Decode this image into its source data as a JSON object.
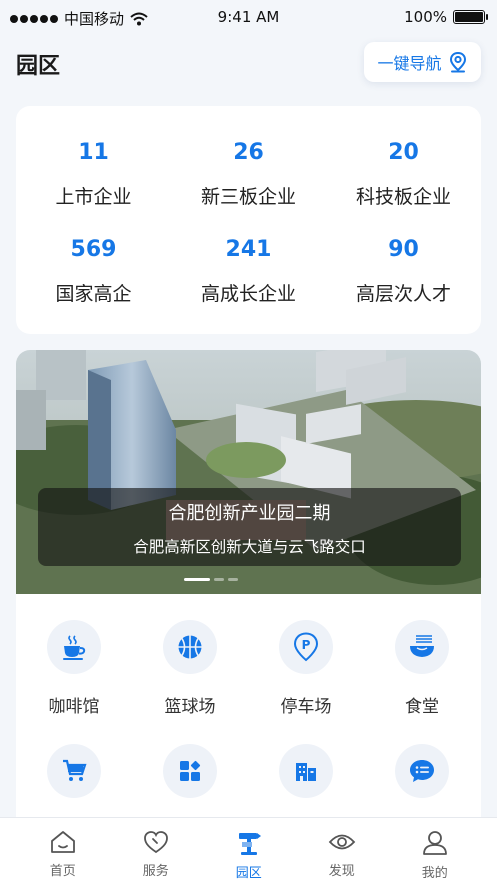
{
  "status_bar": {
    "carrier": "中国移动",
    "time": "9:41 AM",
    "battery": "100%"
  },
  "header": {
    "title": "园区",
    "nav_button": "一键导航"
  },
  "stats": [
    {
      "value": "11",
      "label": "上市企业"
    },
    {
      "value": "26",
      "label": "新三板企业"
    },
    {
      "value": "20",
      "label": "科技板企业"
    },
    {
      "value": "569",
      "label": "国家高企"
    },
    {
      "value": "241",
      "label": "高成长企业"
    },
    {
      "value": "90",
      "label": "高层次人才"
    }
  ],
  "banner": {
    "title": "合肥创新产业园二期",
    "address": "合肥高新区创新大道与云飞路交口",
    "slides": 3,
    "active_slide": 1
  },
  "facilities": [
    {
      "label": "咖啡馆",
      "icon": "coffee-icon"
    },
    {
      "label": "篮球场",
      "icon": "basketball-icon"
    },
    {
      "label": "停车场",
      "icon": "parking-icon"
    },
    {
      "label": "食堂",
      "icon": "canteen-icon"
    },
    {
      "label": "",
      "icon": "shopping-cart-icon"
    },
    {
      "label": "",
      "icon": "apps-icon"
    },
    {
      "label": "",
      "icon": "building-icon"
    },
    {
      "label": "",
      "icon": "message-icon"
    }
  ],
  "tabbar": {
    "items": [
      {
        "label": "首页",
        "icon": "home-icon"
      },
      {
        "label": "服务",
        "icon": "heart-icon"
      },
      {
        "label": "园区",
        "icon": "park-signpost-icon"
      },
      {
        "label": "发现",
        "icon": "eye-icon"
      },
      {
        "label": "我的",
        "icon": "user-icon"
      }
    ],
    "active": "园区"
  },
  "colors": {
    "accent": "#1677e6",
    "background": "#f3f6fa",
    "icon_circle": "#eef2f8"
  }
}
